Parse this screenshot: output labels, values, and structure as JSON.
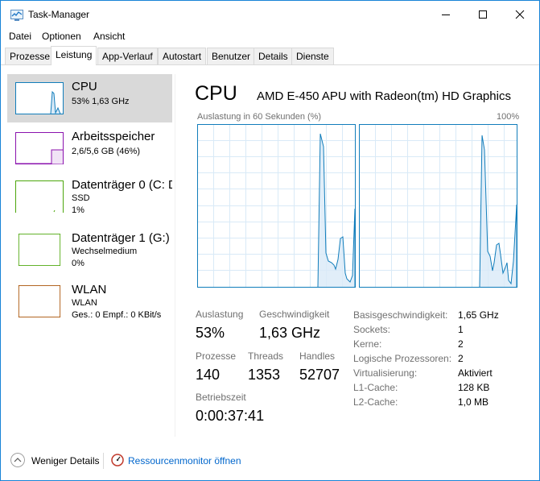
{
  "window": {
    "title": "Task-Manager",
    "accent_color": "#1883d7",
    "icons": {
      "app": "task-manager-icon",
      "minimize": "minimize-icon",
      "maximize": "maximize-icon",
      "close": "close-icon"
    }
  },
  "menu": [
    "Datei",
    "Optionen",
    "Ansicht"
  ],
  "tabs": [
    {
      "label": "Prozesse",
      "active": false
    },
    {
      "label": "Leistung",
      "active": true
    },
    {
      "label": "App-Verlauf",
      "active": false
    },
    {
      "label": "Autostart",
      "active": false
    },
    {
      "label": "Benutzer",
      "active": false
    },
    {
      "label": "Details",
      "active": false
    },
    {
      "label": "Dienste",
      "active": false
    }
  ],
  "sidebar": [
    {
      "title": "CPU",
      "lines": [
        "53% 1,63 GHz"
      ],
      "color": "#117dbb",
      "selected": true
    },
    {
      "title": "Arbeitsspeicher",
      "lines": [
        "2,6/5,6 GB (46%)"
      ],
      "color": "#8b12ae",
      "selected": false
    },
    {
      "title": "Datenträger 0 (C: D",
      "lines": [
        "SSD",
        "1%"
      ],
      "color": "#4da60c",
      "selected": false
    },
    {
      "title": "Datenträger 1 (G:)",
      "lines": [
        "Wechselmedium",
        "0%"
      ],
      "color": "#4da60c",
      "selected": false
    },
    {
      "title": "WLAN",
      "lines": [
        "WLAN",
        "Ges.: 0 Empf.: 0 KBit/s"
      ],
      "color": "#a74f01",
      "selected": false
    }
  ],
  "main": {
    "title": "CPU",
    "model": "AMD E-450 APU with Radeon(tm) HD Graphics",
    "graph_label": "Auslastung in 60 Sekunden (%)",
    "graph_max": "100%",
    "graph_color": "#117dbb"
  },
  "stats": {
    "auslastung_label": "Auslastung",
    "auslastung_val": "53%",
    "geschwindigkeit_label": "Geschwindigkeit",
    "geschwindigkeit_val": "1,63 GHz",
    "prozesse_label": "Prozesse",
    "prozesse_val": "140",
    "threads_label": "Threads",
    "threads_val": "1353",
    "handles_label": "Handles",
    "handles_val": "52707",
    "betriebszeit_label": "Betriebszeit",
    "betriebszeit_val": "0:00:37:41"
  },
  "info": [
    {
      "label": "Basisgeschwindigkeit:",
      "value": "1,65 GHz"
    },
    {
      "label": "Sockets:",
      "value": "1"
    },
    {
      "label": "Kerne:",
      "value": "2"
    },
    {
      "label": "Logische Prozessoren:",
      "value": "2"
    },
    {
      "label": "Virtualisierung:",
      "value": "Aktiviert"
    },
    {
      "label": "L1-Cache:",
      "value": "128 KB"
    },
    {
      "label": "L2-Cache:",
      "value": "1,0 MB"
    }
  ],
  "footer": {
    "fewer_details": "Weniger Details",
    "resmon_link": "Ressourcenmonitor öffnen",
    "icons": {
      "fewer": "chevron-up-icon",
      "resmon": "resource-monitor-icon"
    }
  }
}
